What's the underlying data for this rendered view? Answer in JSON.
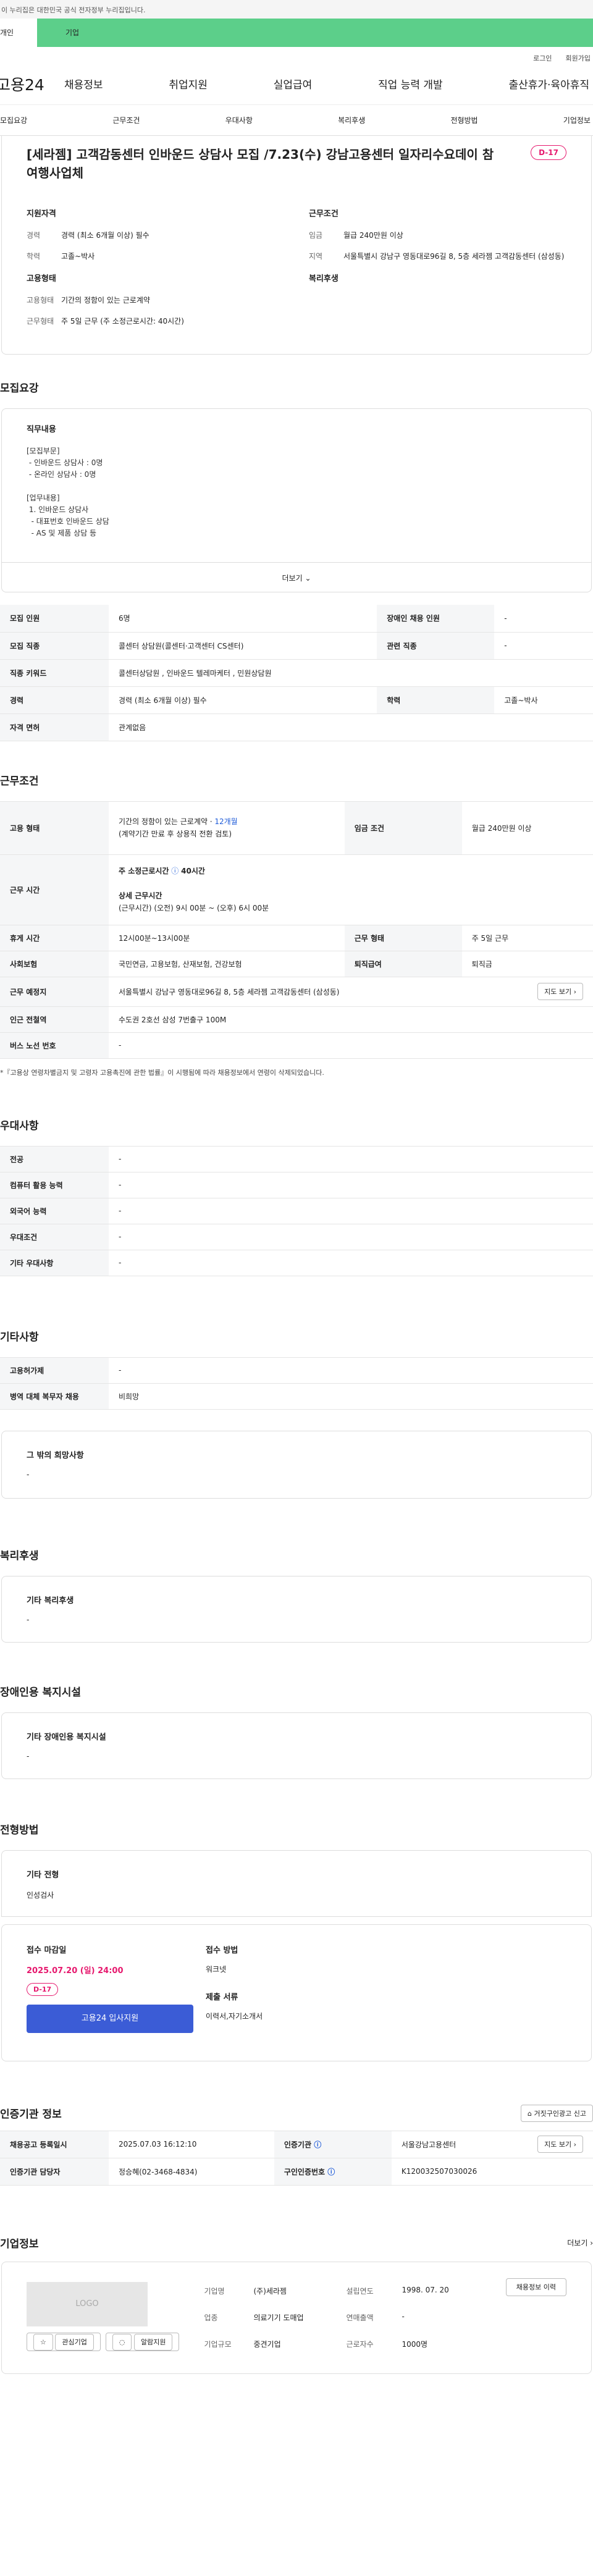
{
  "gov_banner": "이 누리집은 대한민국 공식 전자정부 누리집입니다.",
  "tabs": [
    "개인",
    "기업"
  ],
  "util": [
    "로그인",
    "회원가입"
  ],
  "logo": "고용24",
  "gnb": [
    "채용정보",
    "취업지원",
    "실업급여",
    "직업 능력 개발",
    "출산휴가·육아휴직"
  ],
  "subnav": [
    "모집요강",
    "근무조건",
    "우대사항",
    "복리후생",
    "전형방법",
    "기업정보"
  ],
  "header": {
    "title": "[세라젬] 고객감동센터 인바운드 상담사 모집 /7.23(수) 강남고용센터 일자리수요데이 참여행사업체",
    "dday": "D-17",
    "qual_title": "지원자격",
    "qual": [
      {
        "k": "경력",
        "v": "경력 (최소 6개월 이상) 필수"
      },
      {
        "k": "학력",
        "v": "고졸~박사"
      }
    ],
    "work_title": "근무조건",
    "work": [
      {
        "k": "임금",
        "v": "월급 240만원 이상"
      },
      {
        "k": "지역",
        "v": "서울특별시 강남구 영동대로96길 8, 5층 세라젬 고객감동센터 (삼성동)"
      }
    ],
    "emp_title": "고용형태",
    "emp": [
      {
        "k": "고용형태",
        "v": "기간의 정함이 있는 근로계약"
      },
      {
        "k": "근무형태",
        "v": "주 5일 근무 (주 소정근로시간: 40시간)"
      }
    ],
    "welfare_title": "복리후생"
  },
  "recruit": {
    "title": "모집요강",
    "desc_title": "직무내용",
    "desc": "[모집부문]\n - 인바운드 상담사 : 0명\n - 온라인 상담사 : 0명\n\n[업무내용]\n 1. 인바운드 상담사\n  - 대표번호 인바운드 상담\n  - AS 및 제품 상담 등",
    "more": "더보기",
    "rows": [
      [
        "모집 인원",
        "6명",
        "장애인 채용 인원",
        "-"
      ],
      [
        "모집 직종",
        "콜센터 상담원(콜센터·고객센터 CS센터)",
        "관련 직종",
        "-"
      ],
      [
        "직종 키워드",
        "콜센터상담원 , 인바운드 텔레마케터 , 민원상담원"
      ],
      [
        "경력",
        "경력 (최소 6개월 이상) 필수",
        "학력",
        "고졸~박사"
      ],
      [
        "자격 면허",
        "관계없음"
      ]
    ]
  },
  "cond": {
    "title": "근무조건",
    "emp_k": "고용 형태",
    "emp_v1": "기간의 정함이 있는 근로계약 · ",
    "emp_v1b": "12개월",
    "emp_v2": "(계약기간 만료 후 상용직 전환 검토)",
    "wage_k": "임금 조건",
    "wage_v": "월급 240만원 이상",
    "time_k": "근무 시간",
    "time_v1": "주 소정근로시간",
    "time_v1b": "40시간",
    "time_v2": "상세 근무시간",
    "time_v3": "(근무시간) (오전) 9시 00분 ~ (오후) 6시 00분",
    "rows": [
      [
        "휴게 시간",
        "12시00분~13시00분",
        "근무 형태",
        "주 5일 근무"
      ],
      [
        "사회보험",
        "국민연금, 고용보험, 산재보험, 건강보험",
        "퇴직급여",
        "퇴직금"
      ]
    ],
    "place_k": "근무 예정지",
    "place_v": "서울특별시 강남구 영동대로96길 8, 5층 세라젬 고객감동센터 (삼성동)",
    "map_btn": "지도 보기",
    "rows2": [
      [
        "인근 전철역",
        "수도권 2호선 삼성 7번출구 100M"
      ],
      [
        "버스 노선 번호",
        "-"
      ]
    ],
    "note": "*『고용상 연령차별금지 및 고령자 고용촉진에 관한 법률』이 시행됨에 따라 채용정보에서 연령이 삭제되었습니다."
  },
  "pref": {
    "title": "우대사항",
    "rows": [
      [
        "전공",
        "-"
      ],
      [
        "컴퓨터 활용 능력",
        "-"
      ],
      [
        "외국어 능력",
        "-"
      ],
      [
        "우대조건",
        "-"
      ],
      [
        "기타 우대사항",
        "-"
      ]
    ]
  },
  "etc": {
    "title": "기타사항",
    "rows": [
      [
        "고용허가제",
        "-"
      ],
      [
        "병역 대체 복무자 채용",
        "비희망"
      ]
    ],
    "hope_title": "그 밖의 희망사항",
    "hope_v": "-"
  },
  "benefit": {
    "title": "복리후생",
    "sub": "기타 복리후생",
    "v": "-"
  },
  "disabled": {
    "title": "장애인용 복지시설",
    "sub": "기타 장애인용 복지시설",
    "v": "-"
  },
  "screen": {
    "title": "전형방법",
    "sub": "기타 전형",
    "v": "인성검사",
    "deadline_k": "접수 마감일",
    "deadline_v": "2025.07.20 (일) 24:00",
    "dday": "D-17",
    "apply_btn": "고용24 입사지원",
    "method_k": "접수 방법",
    "method_v": "워크넷",
    "docs_k": "제출 서류",
    "docs_v": "이력서,자기소개서"
  },
  "agency": {
    "title": "인증기관 정보",
    "report_btn": "거짓구인광고 신고",
    "rows": [
      [
        "채용공고 등록일시",
        "2025.07.03 16:12:10",
        "인증기관",
        "서울강남고용센터"
      ],
      [
        "인증기관 담당자",
        "정승혜(02-3468-4834)",
        "구인인증번호",
        "K120032507030026"
      ]
    ],
    "map_btn": "지도 보기"
  },
  "company": {
    "title": "기업정보",
    "more": "더보기",
    "logo": "LOGO",
    "fav": "관심기업",
    "alarm": "알람지원",
    "grid": [
      [
        "기업명",
        "(주)세라젬",
        "설립연도",
        "1998. 07. 20"
      ],
      [
        "업종",
        "의료기기 도매업",
        "연매출액",
        "-"
      ],
      [
        "기업규모",
        "중견기업",
        "근로자수",
        "1000명"
      ]
    ],
    "jobs_btn": "채용정보 이력"
  }
}
